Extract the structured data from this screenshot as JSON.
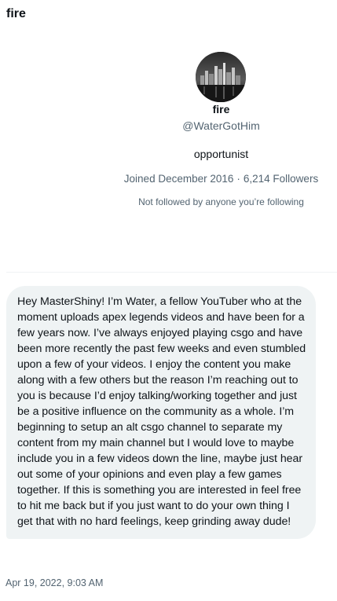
{
  "header": {
    "title": "fire"
  },
  "profile": {
    "name": "fire",
    "handle": "@WaterGotHim",
    "bio": "opportunist",
    "joined": "Joined December 2016",
    "separator": "·",
    "followers": "6,214 Followers",
    "follow_note": "Not followed by anyone you’re following"
  },
  "conversation": {
    "messages": [
      {
        "text": "Hey MasterShiny! I’m Water, a fellow YouTuber who at the moment uploads apex legends videos and have been for a few years now. I’ve always enjoyed playing csgo and have been more recently the past few weeks and even stumbled upon a few of your videos. I enjoy the content you make along with a few others but the reason I’m reaching out to you is because I’d enjoy talking/working together and just be a positive influence on the community as a whole. I’m beginning to setup an alt csgo channel to separate my content from my main channel but I would love to maybe include you in a few videos down the line, maybe just hear out some of your opinions and even play a few games together. If this is something you are interested in feel free to hit me back but if you just want to do your own thing I get that with no hard feelings, keep grinding away dude!",
        "timestamp": "Apr 19, 2022, 9:03 AM"
      }
    ]
  },
  "colors": {
    "text_primary": "#0f1419",
    "text_secondary": "#536471",
    "bubble_background": "#eff3f4"
  }
}
